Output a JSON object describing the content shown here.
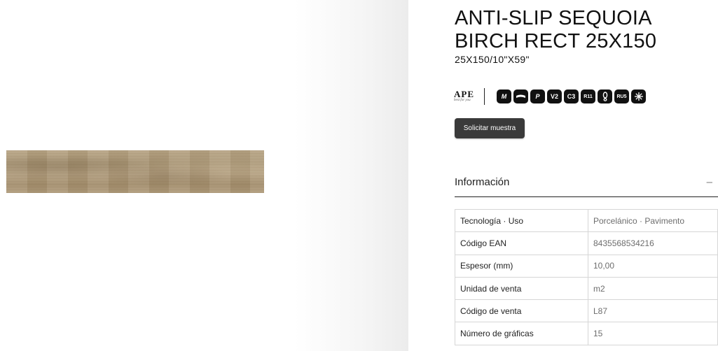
{
  "product": {
    "title": "ANTI-SLIP SEQUOIA BIRCH RECT 25X150",
    "subtitle": "25X150/10\"X59\""
  },
  "brand": {
    "name": "APE",
    "tagline": "best for you"
  },
  "tech_icons": [
    {
      "name": "m-slab-icon",
      "label": "M"
    },
    {
      "name": "shade-variation-icon",
      "label": ""
    },
    {
      "name": "p-icon",
      "label": "P"
    },
    {
      "name": "v2-icon",
      "label": "V2"
    },
    {
      "name": "c3-icon",
      "label": "C3"
    },
    {
      "name": "r11-icon",
      "label": "R11"
    },
    {
      "name": "foot-slip-icon",
      "label": ""
    },
    {
      "name": "ru5-icon",
      "label": "RU5"
    },
    {
      "name": "frost-resistant-icon",
      "label": ""
    }
  ],
  "actions": {
    "sample_label": "Solicitar muestra"
  },
  "info": {
    "title": "Información",
    "collapse_symbol": "–",
    "rows": [
      {
        "label": "Tecnología · Uso",
        "value": "Porcelánico · Pavimento"
      },
      {
        "label": "Código EAN",
        "value": "8435568534216"
      },
      {
        "label": "Espesor (mm)",
        "value": "10,00"
      },
      {
        "label": "Unidad de venta",
        "value": "m2"
      },
      {
        "label": "Código de venta",
        "value": "L87"
      },
      {
        "label": "Número de gráficas",
        "value": "15"
      }
    ]
  },
  "colors": {
    "button_bg": "#3a3a3a",
    "icon_bg": "#111111",
    "tile_wood": "#ad9a7a"
  }
}
